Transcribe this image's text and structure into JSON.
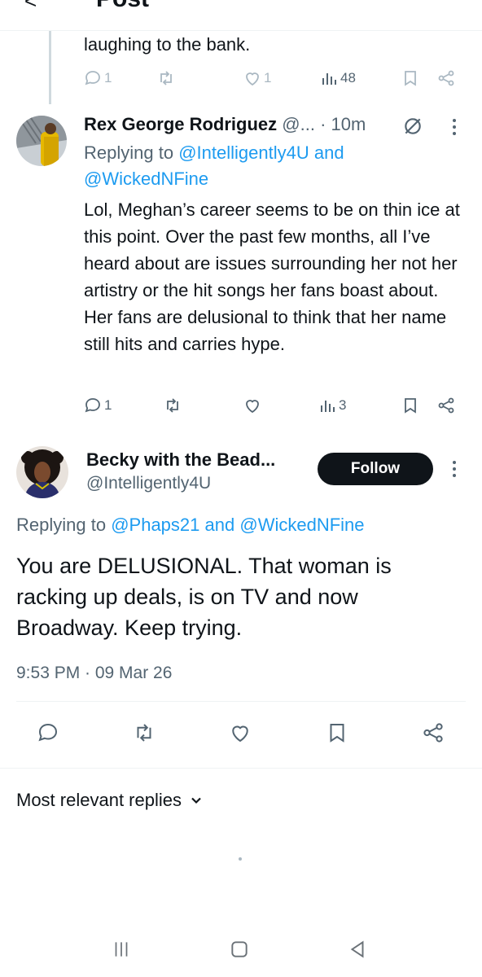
{
  "header": {
    "back_glyph": "<",
    "title": "Post"
  },
  "previous_fragment": {
    "text": "laughing to the bank.",
    "replies": "1",
    "likes": "1",
    "views": "48"
  },
  "reply": {
    "name": "Rex George Rodriguez",
    "handle": "@...",
    "separator": "·",
    "time": "10m",
    "replying_label": "Replying to",
    "mention_1": "@Intelligently4U",
    "and_text": "and",
    "mention_2": "@WickedNFine",
    "body": "Lol, Meghan’s career seems to be on thin ice at this point. Over the past few months, all I’ve heard about are issues surrounding her not her artistry or the hit songs her fans boast about. Her fans are delusional to think that her name still hits and carries hype.",
    "replies": "1",
    "views": "3"
  },
  "main": {
    "name": "Becky with the Bead...",
    "handle": "@Intelligently4U",
    "follow_label": "Follow",
    "replying_label": "Replying to",
    "mention_1": "@Phaps21",
    "and_text": "and",
    "mention_2": "@WickedNFine",
    "body": "You are DELUSIONAL. That woman is racking up deals, is on TV and now Broadway. Keep trying.",
    "timestamp": "9:53 PM · 09 Mar 26"
  },
  "sort": {
    "label": "Most relevant replies"
  },
  "colors": {
    "accent": "#1d9bf0",
    "text": "#0f1419",
    "muted": "#536471",
    "divider": "#eff3f4"
  },
  "icons": [
    "back-icon",
    "reply-icon",
    "retweet-icon",
    "like-icon",
    "views-icon",
    "bookmark-icon",
    "share-icon",
    "more-icon",
    "grok-icon",
    "chevron-down-icon",
    "nav-recents-icon",
    "nav-home-icon",
    "nav-back-icon"
  ]
}
